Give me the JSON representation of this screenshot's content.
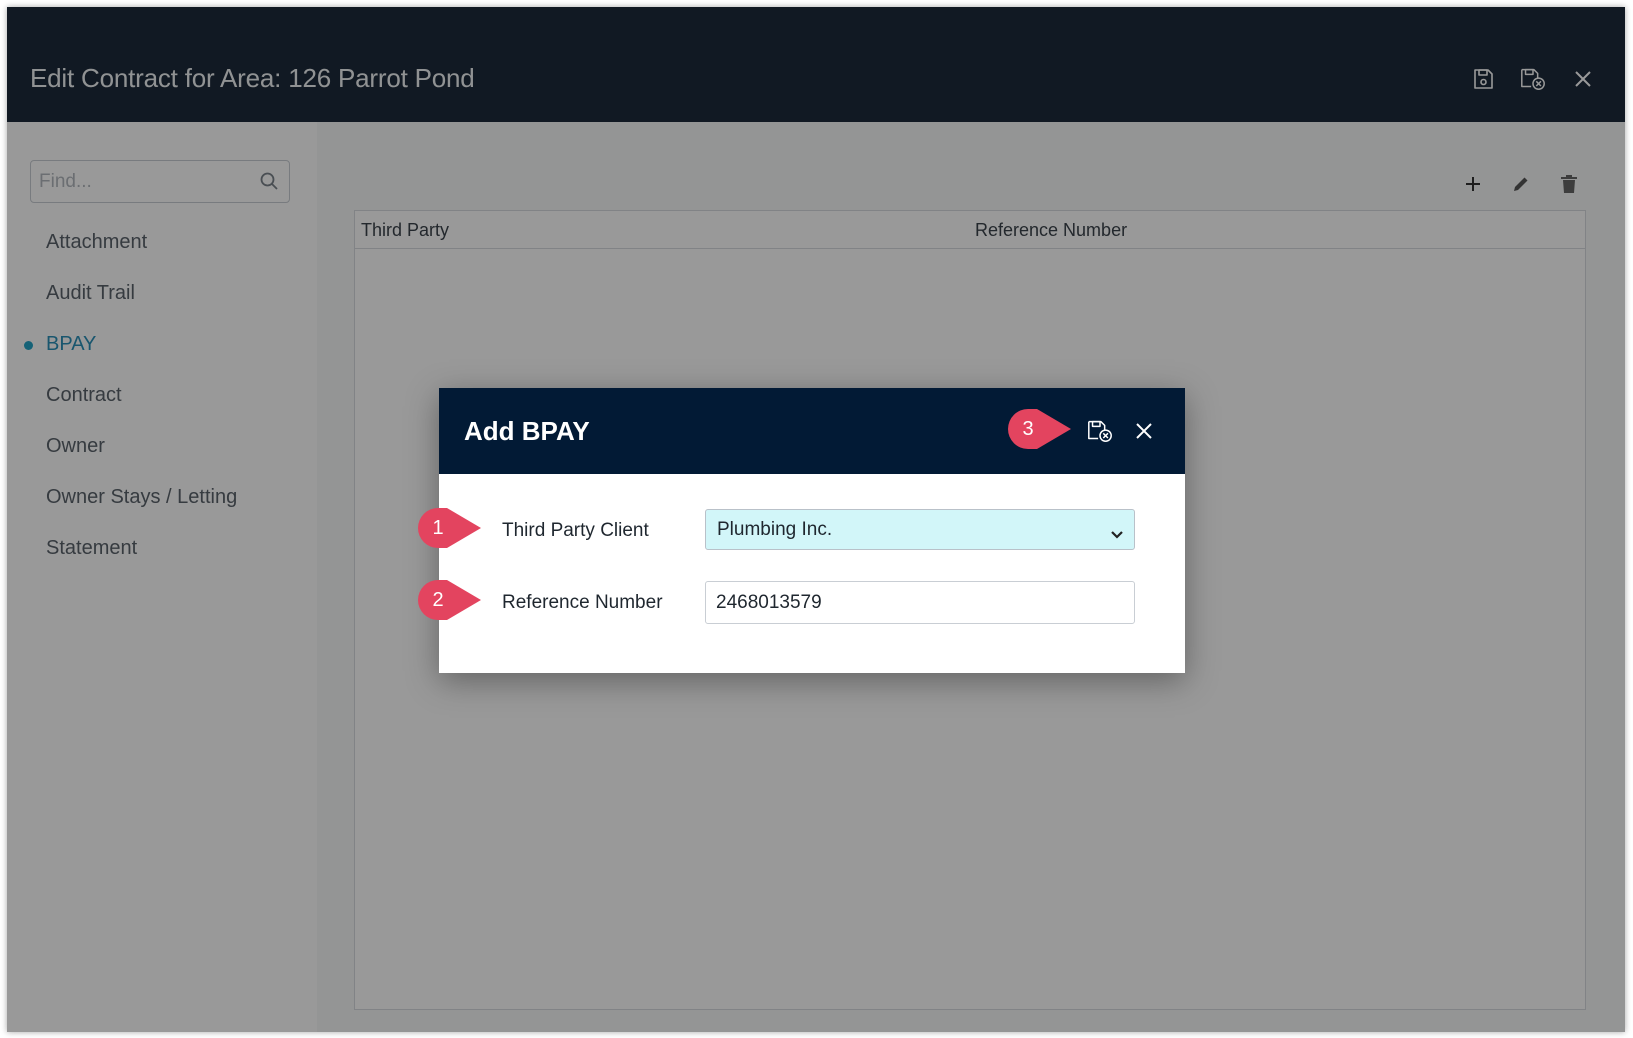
{
  "window": {
    "title": "Edit Contract for Area: 126 Parrot Pond",
    "icons": [
      "save-icon",
      "save-close-icon",
      "close-icon"
    ]
  },
  "sidebar": {
    "search_placeholder": "Find...",
    "items": [
      {
        "label": "Attachment",
        "active": false
      },
      {
        "label": "Audit Trail",
        "active": false
      },
      {
        "label": "BPAY",
        "active": true
      },
      {
        "label": "Contract",
        "active": false
      },
      {
        "label": "Owner",
        "active": false
      },
      {
        "label": "Owner Stays / Letting",
        "active": false
      },
      {
        "label": "Statement",
        "active": false
      }
    ]
  },
  "main": {
    "tools": [
      "plus-icon",
      "pencil-icon",
      "trash-icon"
    ],
    "columns": [
      "Third Party",
      "Reference Number"
    ]
  },
  "modal": {
    "title": "Add BPAY",
    "fields": {
      "third_party_client": {
        "label": "Third Party Client",
        "value": "Plumbing Inc."
      },
      "reference_number": {
        "label": "Reference Number",
        "value": "2468013579"
      }
    }
  },
  "callouts": [
    "1",
    "2",
    "3"
  ],
  "colors": {
    "titlebar": "#1d2b3b",
    "modal_header": "#021a35",
    "accent": "#24a3c6",
    "callout": "#e3445f",
    "select_bg": "#d2f6f9"
  }
}
